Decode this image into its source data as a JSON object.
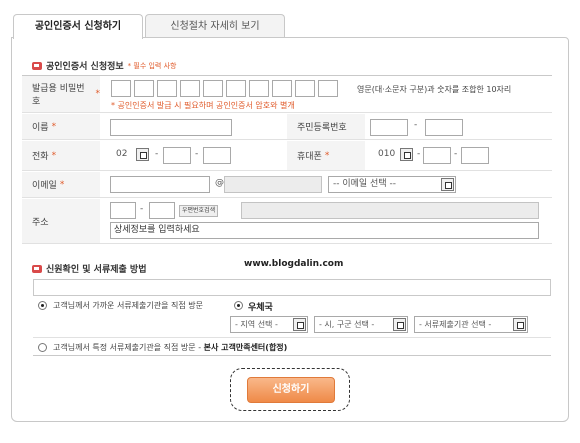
{
  "tabs": {
    "active": "공인인증서 신청하기",
    "inactive": "신청절차 자세히 보기"
  },
  "section1": {
    "title": "공인인증서 신청정보",
    "required_note": "* 필수 입력 사항"
  },
  "form": {
    "password": {
      "label": "발급용 비밀번호",
      "hint": "영문(대·소문자 구분)과 숫자를 조합한 10자리",
      "note": "* 공인인증서 발급 시 필요하며 공인인증서 암호와 별개"
    },
    "name": {
      "label": "이름"
    },
    "ssn": {
      "label": "주민등록번호",
      "dash": "-"
    },
    "phone": {
      "label": "전화",
      "prefix": "02",
      "dash": "-"
    },
    "mobile": {
      "label": "휴대폰",
      "prefix": "010",
      "dash": "-"
    },
    "email": {
      "label": "이메일",
      "at": "@",
      "select": "-- 이메일 선택 --"
    },
    "address": {
      "label": "주소",
      "dash": "-",
      "zip_button": "우편번호검색",
      "detail_placeholder": "상세정보를 입력하세요"
    },
    "star": "*"
  },
  "section2": {
    "title": "신원확인 및 서류제출 방법"
  },
  "method": {
    "option1": "고객님께서 가까운 서류제출기관을 직접 방문",
    "post": "우체국",
    "region": "- 지역 선택 -",
    "city": "- 시, 구군 선택 -",
    "agency": "- 서류제출기관 선택 -",
    "option2_prefix": "고객님께서 특정 서류제출기관을 직접 방문 - ",
    "option2_place": "본사 고객만족센터(합정)"
  },
  "submit": "신청하기",
  "watermark": "www.blogdalin.com"
}
